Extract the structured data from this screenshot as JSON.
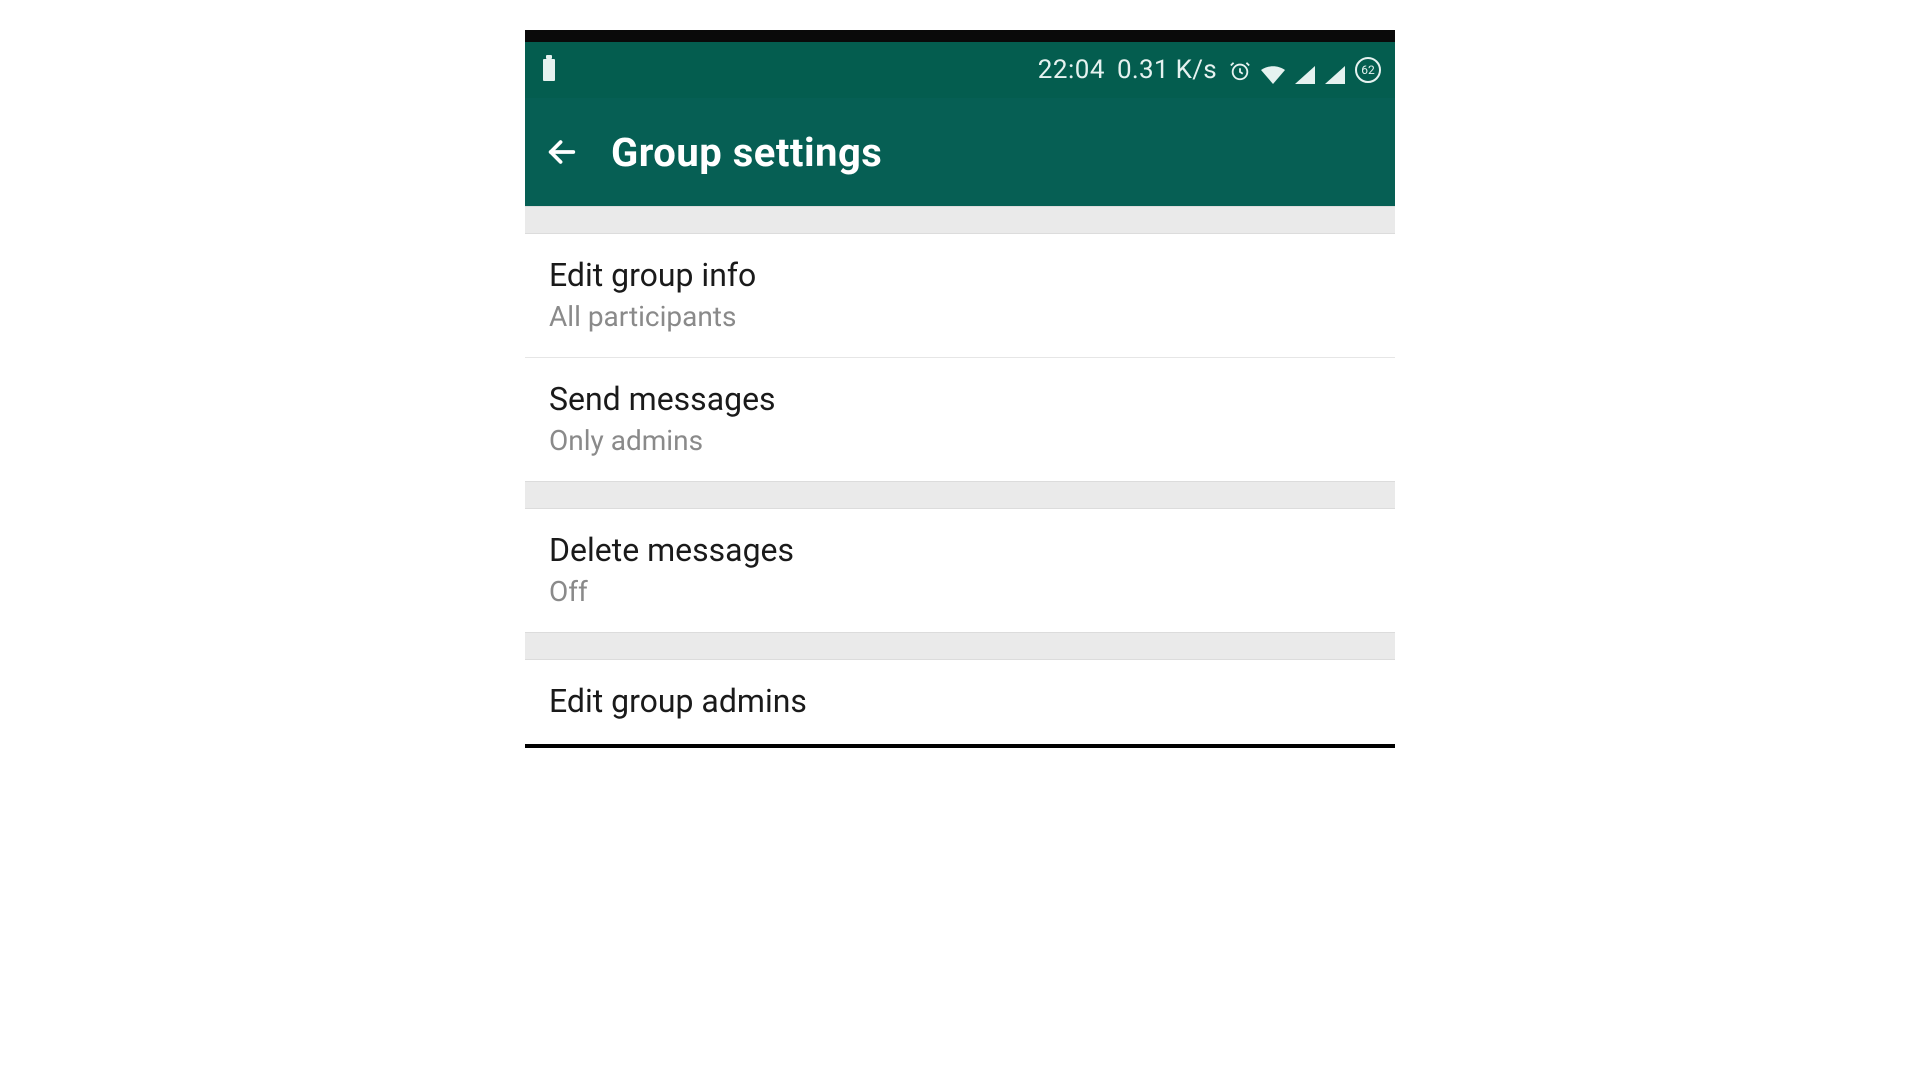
{
  "status_bar": {
    "time": "22:04",
    "network_speed": "0.31 K/s",
    "badge_value": "62"
  },
  "toolbar": {
    "title": "Group settings"
  },
  "group1": {
    "items": [
      {
        "title": "Edit group info",
        "subtitle": "All participants"
      },
      {
        "title": "Send messages",
        "subtitle": "Only admins"
      }
    ]
  },
  "group2": {
    "items": [
      {
        "title": "Delete messages",
        "subtitle": "Off"
      }
    ]
  },
  "group3": {
    "items": [
      {
        "title": "Edit group admins"
      }
    ]
  },
  "colors": {
    "toolbar_bg": "#065f54",
    "status_bg": "#045d4f",
    "text_primary": "#1a1a1a",
    "text_secondary": "#8a8a8a"
  }
}
